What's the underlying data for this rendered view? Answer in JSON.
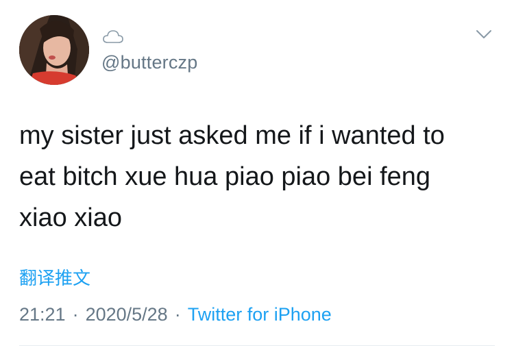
{
  "user": {
    "handle": "@butterczp",
    "avatar_icon": "profile-photo",
    "badge_icon": "cloud-icon"
  },
  "tweet": {
    "text": "my sister just asked me if i wanted to eat bitch xue hua piao piao bei feng xiao xiao",
    "translate_label": "翻译推文",
    "time": "21:21",
    "separator": "·",
    "date": "2020/5/28",
    "source": "Twitter for iPhone"
  },
  "menu": {
    "icon": "chevron-down-icon"
  },
  "colors": {
    "link": "#1da1f2",
    "secondary": "#657786",
    "text": "#14171a",
    "divider": "#e6ecf0"
  }
}
